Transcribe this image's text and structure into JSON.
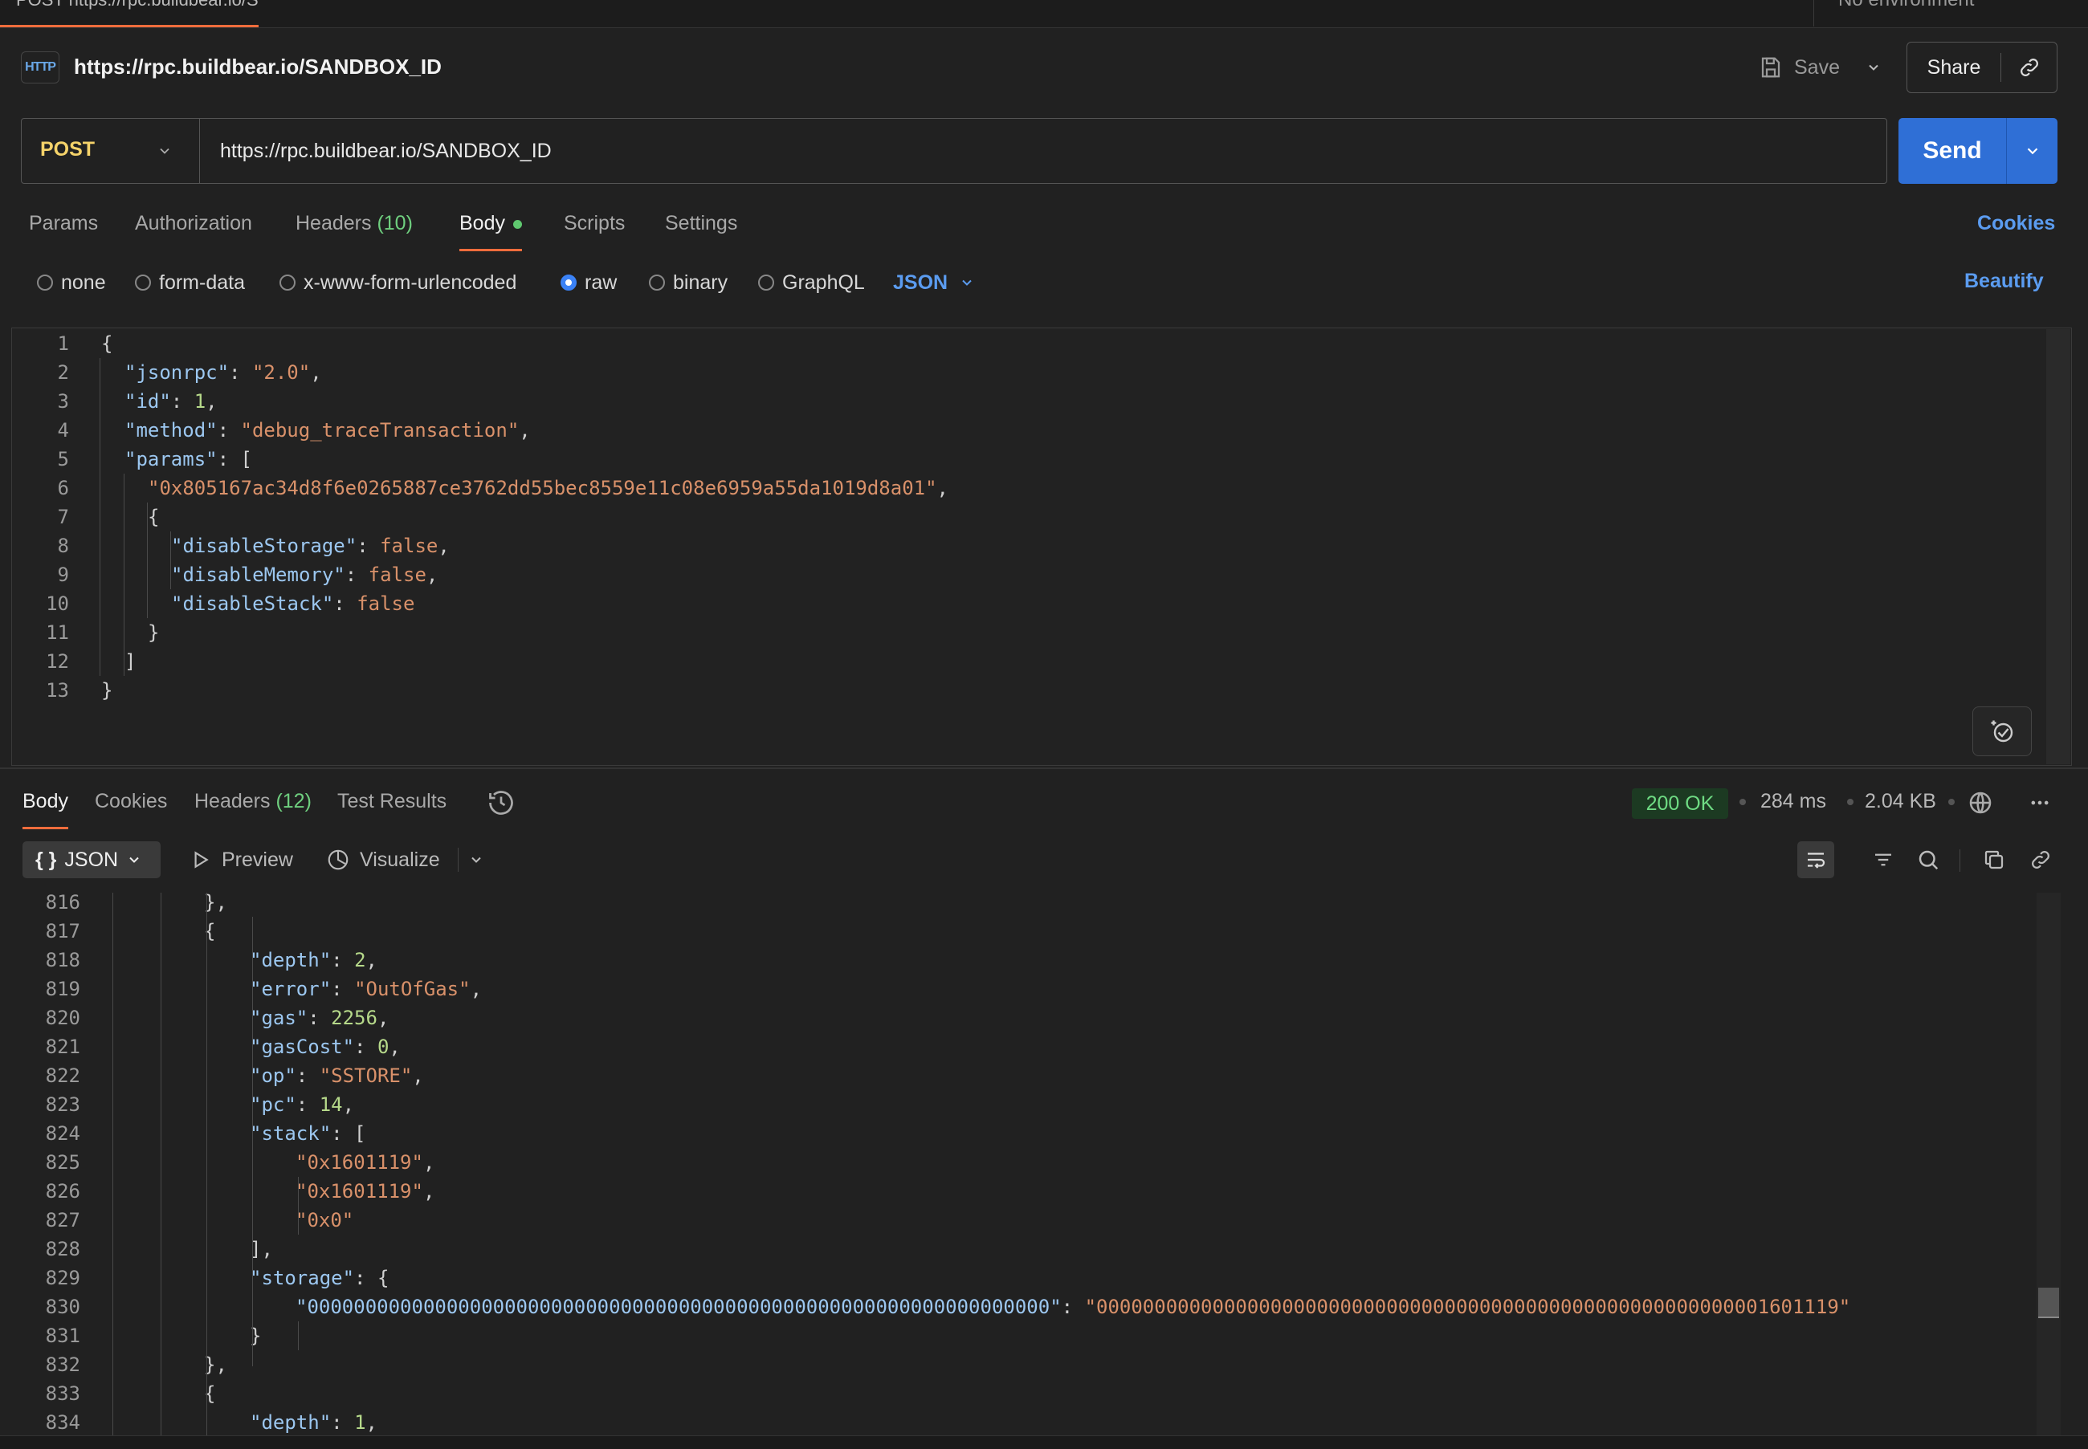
{
  "tab": {
    "label": "POST https://rpc.buildbear.io/S"
  },
  "environment": {
    "label": "No environment"
  },
  "request": {
    "icon_label": "HTTP",
    "title": "https://rpc.buildbear.io/SANDBOX_ID",
    "save_label": "Save",
    "share_label": "Share",
    "method": "POST",
    "url": "https://rpc.buildbear.io/SANDBOX_ID",
    "send_label": "Send"
  },
  "request_tabs": {
    "params": "Params",
    "authorization": "Authorization",
    "headers": "Headers",
    "headers_count": "(10)",
    "body": "Body",
    "scripts": "Scripts",
    "settings": "Settings",
    "cookies": "Cookies"
  },
  "body_types": {
    "none": "none",
    "form_data": "form-data",
    "urlencoded": "x-www-form-urlencoded",
    "raw": "raw",
    "binary": "binary",
    "graphql": "GraphQL",
    "format": "JSON",
    "beautify": "Beautify",
    "selected": "raw"
  },
  "request_body": [
    {
      "n": "1",
      "code": "{"
    },
    {
      "n": "2",
      "code": "\"jsonrpc\": \"2.0\","
    },
    {
      "n": "3",
      "code": "\"id\": 1,"
    },
    {
      "n": "4",
      "code": "\"method\": \"debug_traceTransaction\","
    },
    {
      "n": "5",
      "code": "\"params\": ["
    },
    {
      "n": "6",
      "code": "\"0x805167ac34d8f6e0265887ce3762dd55bec8559e11c08e6959a55da1019d8a01\","
    },
    {
      "n": "7",
      "code": "{"
    },
    {
      "n": "8",
      "code": "\"disableStorage\": false,"
    },
    {
      "n": "9",
      "code": "\"disableMemory\": false,"
    },
    {
      "n": "10",
      "code": "\"disableStack\": false"
    },
    {
      "n": "11",
      "code": "}"
    },
    {
      "n": "12",
      "code": "]"
    },
    {
      "n": "13",
      "code": "}"
    }
  ],
  "response_tabs": {
    "body": "Body",
    "cookies": "Cookies",
    "headers": "Headers",
    "headers_count": "(12)",
    "test_results": "Test Results"
  },
  "response_meta": {
    "status": "200 OK",
    "time": "284 ms",
    "size": "2.04 KB"
  },
  "response_toolbar": {
    "format": "JSON",
    "format_icon": "{ }",
    "preview": "Preview",
    "visualize": "Visualize"
  },
  "response_body": [
    {
      "n": "816",
      "code": "},"
    },
    {
      "n": "817",
      "code": "{"
    },
    {
      "n": "818",
      "code": "\"depth\": 2,"
    },
    {
      "n": "819",
      "code": "\"error\": \"OutOfGas\","
    },
    {
      "n": "820",
      "code": "\"gas\": 2256,"
    },
    {
      "n": "821",
      "code": "\"gasCost\": 0,"
    },
    {
      "n": "822",
      "code": "\"op\": \"SSTORE\","
    },
    {
      "n": "823",
      "code": "\"pc\": 14,"
    },
    {
      "n": "824",
      "code": "\"stack\": ["
    },
    {
      "n": "825",
      "code": "\"0x1601119\","
    },
    {
      "n": "826",
      "code": "\"0x1601119\","
    },
    {
      "n": "827",
      "code": "\"0x0\""
    },
    {
      "n": "828",
      "code": "],"
    },
    {
      "n": "829",
      "code": "\"storage\": {"
    },
    {
      "n": "830",
      "code": "\"0000000000000000000000000000000000000000000000000000000000000000\": \"0000000000000000000000000000000000000000000000000000000001601119\""
    },
    {
      "n": "831",
      "code": "}"
    },
    {
      "n": "832",
      "code": "},"
    },
    {
      "n": "833",
      "code": "{"
    },
    {
      "n": "834",
      "code": "\"depth\": 1,"
    }
  ],
  "colors": {
    "accent": "#ef6c3c",
    "send": "#2f6fd6",
    "link": "#5b9cf0",
    "method": "#f5d36a",
    "status_ok": "#6fdc84"
  }
}
